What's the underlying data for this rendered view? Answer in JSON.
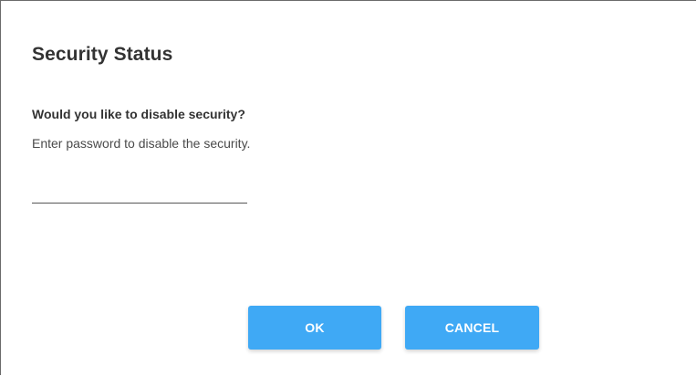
{
  "dialog": {
    "title": "Security Status",
    "question": "Would you like to disable security?",
    "instruction": "Enter password to disable the security.",
    "password": {
      "value": "",
      "placeholder": ""
    },
    "buttons": {
      "ok_label": "OK",
      "cancel_label": "CANCEL"
    }
  },
  "colors": {
    "button_bg": "#3fa9f5",
    "button_text": "#ffffff",
    "title_text": "#333333"
  }
}
